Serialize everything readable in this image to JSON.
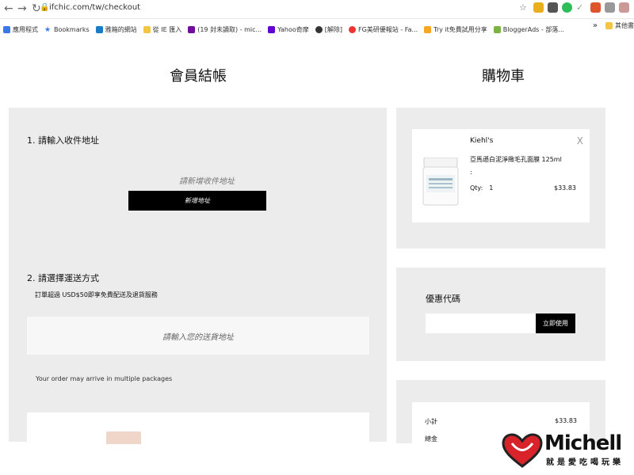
{
  "browser": {
    "url": "ifchic.com/tw/checkout",
    "bookmarks": [
      "應用程式",
      "Bookmarks",
      "雅箱的網站",
      "從 IE 匯入",
      "(19 封未讀取) - mic...",
      "Yahoo奇摩",
      "[解除]",
      "FG美研優報站 - Fa...",
      "Try it免費試用分享",
      "BloggerAds - 部落..."
    ],
    "more": "»",
    "other_bookmarks": "其他書"
  },
  "checkout": {
    "title": "會員結帳",
    "step1_title": "1. 請輸入收件地址",
    "address_hint": "請新增收件地址",
    "add_address_label": "新增地址",
    "step2_title": "2. 請選擇運送方式",
    "shipping_note": "訂單超過 USD$50即享免費配送及退貨服務",
    "shipping_placeholder": "請輸入您的送貨地址",
    "multi_package_note": "Your order may arrive in multiple packages"
  },
  "cart": {
    "title": "購物車",
    "item": {
      "brand": "Kiehl's",
      "name": "亞馬遜白泥淨緻毛孔面膜 125ml",
      "colon": ":",
      "qty_label": "Qty:",
      "qty": "1",
      "price": "$33.83",
      "remove": "X"
    }
  },
  "coupon": {
    "title": "優惠代碼",
    "input_value": "",
    "apply_label": "立即使用"
  },
  "summary": {
    "subtotal_label": "小計",
    "subtotal_value": "$33.83",
    "total_label": "總金"
  },
  "watermark": {
    "name": "Michell",
    "tagline": "就是愛吃喝玩樂"
  },
  "colors": {
    "panel_bg": "#ececec",
    "button_bg": "#000000",
    "heart": "#d8232a"
  }
}
